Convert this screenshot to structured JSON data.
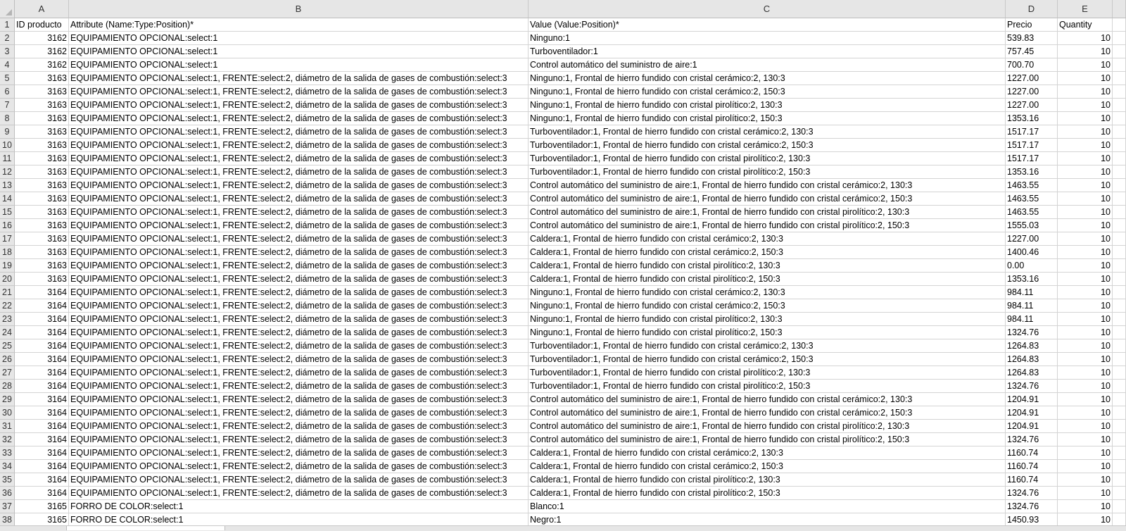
{
  "columns": [
    "A",
    "B",
    "C",
    "D",
    "E"
  ],
  "header_row": {
    "num": "1",
    "id": "ID producto",
    "attr": "Attribute (Name:Type:Position)*",
    "value": "Value (Value:Position)*",
    "price": "Precio",
    "qty": "Quantity"
  },
  "rows": [
    {
      "num": "2",
      "id": "3162",
      "attr": "EQUIPAMIENTO OPCIONAL:select:1",
      "value": "Ninguno:1",
      "price": "539.83",
      "qty": "10"
    },
    {
      "num": "3",
      "id": "3162",
      "attr": "EQUIPAMIENTO OPCIONAL:select:1",
      "value": "Turboventilador:1",
      "price": "757.45",
      "qty": "10"
    },
    {
      "num": "4",
      "id": "3162",
      "attr": "EQUIPAMIENTO OPCIONAL:select:1",
      "value": "Control automático del suministro de aire:1",
      "price": "700.70",
      "qty": "10"
    },
    {
      "num": "5",
      "id": "3163",
      "attr": "EQUIPAMIENTO OPCIONAL:select:1, FRENTE:select:2, diámetro de la salida de gases de combustión:select:3",
      "value": "Ninguno:1, Frontal de hierro fundido con cristal cerámico:2, 130:3",
      "price": "1227.00",
      "qty": "10"
    },
    {
      "num": "6",
      "id": "3163",
      "attr": "EQUIPAMIENTO OPCIONAL:select:1, FRENTE:select:2, diámetro de la salida de gases de combustión:select:3",
      "value": "Ninguno:1, Frontal de hierro fundido con cristal cerámico:2, 150:3",
      "price": "1227.00",
      "qty": "10"
    },
    {
      "num": "7",
      "id": "3163",
      "attr": "EQUIPAMIENTO OPCIONAL:select:1, FRENTE:select:2, diámetro de la salida de gases de combustión:select:3",
      "value": "Ninguno:1, Frontal de hierro fundido con cristal pirolítico:2, 130:3",
      "price": "1227.00",
      "qty": "10"
    },
    {
      "num": "8",
      "id": "3163",
      "attr": "EQUIPAMIENTO OPCIONAL:select:1, FRENTE:select:2, diámetro de la salida de gases de combustión:select:3",
      "value": "Ninguno:1, Frontal de hierro fundido con cristal pirolítico:2, 150:3",
      "price": "1353.16",
      "qty": "10"
    },
    {
      "num": "9",
      "id": "3163",
      "attr": "EQUIPAMIENTO OPCIONAL:select:1, FRENTE:select:2, diámetro de la salida de gases de combustión:select:3",
      "value": "Turboventilador:1, Frontal de hierro fundido con cristal cerámico:2, 130:3",
      "price": "1517.17",
      "qty": "10"
    },
    {
      "num": "10",
      "id": "3163",
      "attr": "EQUIPAMIENTO OPCIONAL:select:1, FRENTE:select:2, diámetro de la salida de gases de combustión:select:3",
      "value": "Turboventilador:1, Frontal de hierro fundido con cristal cerámico:2, 150:3",
      "price": "1517.17",
      "qty": "10"
    },
    {
      "num": "11",
      "id": "3163",
      "attr": "EQUIPAMIENTO OPCIONAL:select:1, FRENTE:select:2, diámetro de la salida de gases de combustión:select:3",
      "value": "Turboventilador:1, Frontal de hierro fundido con cristal pirolítico:2, 130:3",
      "price": "1517.17",
      "qty": "10"
    },
    {
      "num": "12",
      "id": "3163",
      "attr": "EQUIPAMIENTO OPCIONAL:select:1, FRENTE:select:2, diámetro de la salida de gases de combustión:select:3",
      "value": "Turboventilador:1, Frontal de hierro fundido con cristal pirolítico:2, 150:3",
      "price": "1353.16",
      "qty": "10"
    },
    {
      "num": "13",
      "id": "3163",
      "attr": "EQUIPAMIENTO OPCIONAL:select:1, FRENTE:select:2, diámetro de la salida de gases de combustión:select:3",
      "value": "Control automático del suministro de aire:1, Frontal de hierro fundido con cristal cerámico:2, 130:3",
      "price": "1463.55",
      "qty": "10"
    },
    {
      "num": "14",
      "id": "3163",
      "attr": "EQUIPAMIENTO OPCIONAL:select:1, FRENTE:select:2, diámetro de la salida de gases de combustión:select:3",
      "value": "Control automático del suministro de aire:1, Frontal de hierro fundido con cristal cerámico:2, 150:3",
      "price": "1463.55",
      "qty": "10"
    },
    {
      "num": "15",
      "id": "3163",
      "attr": "EQUIPAMIENTO OPCIONAL:select:1, FRENTE:select:2, diámetro de la salida de gases de combustión:select:3",
      "value": "Control automático del suministro de aire:1, Frontal de hierro fundido con cristal pirolítico:2, 130:3",
      "price": "1463.55",
      "qty": "10"
    },
    {
      "num": "16",
      "id": "3163",
      "attr": "EQUIPAMIENTO OPCIONAL:select:1, FRENTE:select:2, diámetro de la salida de gases de combustión:select:3",
      "value": "Control automático del suministro de aire:1, Frontal de hierro fundido con cristal pirolítico:2, 150:3",
      "price": "1555.03",
      "qty": "10"
    },
    {
      "num": "17",
      "id": "3163",
      "attr": "EQUIPAMIENTO OPCIONAL:select:1, FRENTE:select:2, diámetro de la salida de gases de combustión:select:3",
      "value": "Caldera:1, Frontal de hierro fundido con cristal cerámico:2, 130:3",
      "price": "1227.00",
      "qty": "10"
    },
    {
      "num": "18",
      "id": "3163",
      "attr": "EQUIPAMIENTO OPCIONAL:select:1, FRENTE:select:2, diámetro de la salida de gases de combustión:select:3",
      "value": "Caldera:1, Frontal de hierro fundido con cristal cerámico:2, 150:3",
      "price": "1400.46",
      "qty": "10"
    },
    {
      "num": "19",
      "id": "3163",
      "attr": "EQUIPAMIENTO OPCIONAL:select:1, FRENTE:select:2, diámetro de la salida de gases de combustión:select:3",
      "value": "Caldera:1, Frontal de hierro fundido con cristal pirolítico:2, 130:3",
      "price": "0.00",
      "qty": "10"
    },
    {
      "num": "20",
      "id": "3163",
      "attr": "EQUIPAMIENTO OPCIONAL:select:1, FRENTE:select:2, diámetro de la salida de gases de combustión:select:3",
      "value": "Caldera:1, Frontal de hierro fundido con cristal pirolítico:2, 150:3",
      "price": "1353.16",
      "qty": "10"
    },
    {
      "num": "21",
      "id": "3164",
      "attr": "EQUIPAMIENTO OPCIONAL:select:1, FRENTE:select:2, diámetro de la salida de gases de combustión:select:3",
      "value": "Ninguno:1, Frontal de hierro fundido con cristal cerámico:2, 130:3",
      "price": "984.11",
      "qty": "10"
    },
    {
      "num": "22",
      "id": "3164",
      "attr": "EQUIPAMIENTO OPCIONAL:select:1, FRENTE:select:2, diámetro de la salida de gases de combustión:select:3",
      "value": "Ninguno:1, Frontal de hierro fundido con cristal cerámico:2, 150:3",
      "price": "984.11",
      "qty": "10"
    },
    {
      "num": "23",
      "id": "3164",
      "attr": "EQUIPAMIENTO OPCIONAL:select:1, FRENTE:select:2, diámetro de la salida de gases de combustión:select:3",
      "value": "Ninguno:1, Frontal de hierro fundido con cristal pirolítico:2, 130:3",
      "price": "984.11",
      "qty": "10"
    },
    {
      "num": "24",
      "id": "3164",
      "attr": "EQUIPAMIENTO OPCIONAL:select:1, FRENTE:select:2, diámetro de la salida de gases de combustión:select:3",
      "value": "Ninguno:1, Frontal de hierro fundido con cristal pirolítico:2, 150:3",
      "price": "1324.76",
      "qty": "10"
    },
    {
      "num": "25",
      "id": "3164",
      "attr": "EQUIPAMIENTO OPCIONAL:select:1, FRENTE:select:2, diámetro de la salida de gases de combustión:select:3",
      "value": "Turboventilador:1, Frontal de hierro fundido con cristal cerámico:2, 130:3",
      "price": "1264.83",
      "qty": "10"
    },
    {
      "num": "26",
      "id": "3164",
      "attr": "EQUIPAMIENTO OPCIONAL:select:1, FRENTE:select:2, diámetro de la salida de gases de combustión:select:3",
      "value": "Turboventilador:1, Frontal de hierro fundido con cristal cerámico:2, 150:3",
      "price": "1264.83",
      "qty": "10"
    },
    {
      "num": "27",
      "id": "3164",
      "attr": "EQUIPAMIENTO OPCIONAL:select:1, FRENTE:select:2, diámetro de la salida de gases de combustión:select:3",
      "value": "Turboventilador:1, Frontal de hierro fundido con cristal pirolítico:2, 130:3",
      "price": "1264.83",
      "qty": "10"
    },
    {
      "num": "28",
      "id": "3164",
      "attr": "EQUIPAMIENTO OPCIONAL:select:1, FRENTE:select:2, diámetro de la salida de gases de combustión:select:3",
      "value": "Turboventilador:1, Frontal de hierro fundido con cristal pirolítico:2, 150:3",
      "price": "1324.76",
      "qty": "10"
    },
    {
      "num": "29",
      "id": "3164",
      "attr": "EQUIPAMIENTO OPCIONAL:select:1, FRENTE:select:2, diámetro de la salida de gases de combustión:select:3",
      "value": "Control automático del suministro de aire:1, Frontal de hierro fundido con cristal cerámico:2, 130:3",
      "price": "1204.91",
      "qty": "10"
    },
    {
      "num": "30",
      "id": "3164",
      "attr": "EQUIPAMIENTO OPCIONAL:select:1, FRENTE:select:2, diámetro de la salida de gases de combustión:select:3",
      "value": "Control automático del suministro de aire:1, Frontal de hierro fundido con cristal cerámico:2, 150:3",
      "price": "1204.91",
      "qty": "10"
    },
    {
      "num": "31",
      "id": "3164",
      "attr": "EQUIPAMIENTO OPCIONAL:select:1, FRENTE:select:2, diámetro de la salida de gases de combustión:select:3",
      "value": "Control automático del suministro de aire:1, Frontal de hierro fundido con cristal pirolítico:2, 130:3",
      "price": "1204.91",
      "qty": "10"
    },
    {
      "num": "32",
      "id": "3164",
      "attr": "EQUIPAMIENTO OPCIONAL:select:1, FRENTE:select:2, diámetro de la salida de gases de combustión:select:3",
      "value": "Control automático del suministro de aire:1, Frontal de hierro fundido con cristal pirolítico:2, 150:3",
      "price": "1324.76",
      "qty": "10"
    },
    {
      "num": "33",
      "id": "3164",
      "attr": "EQUIPAMIENTO OPCIONAL:select:1, FRENTE:select:2, diámetro de la salida de gases de combustión:select:3",
      "value": "Caldera:1, Frontal de hierro fundido con cristal cerámico:2, 130:3",
      "price": "1160.74",
      "qty": "10"
    },
    {
      "num": "34",
      "id": "3164",
      "attr": "EQUIPAMIENTO OPCIONAL:select:1, FRENTE:select:2, diámetro de la salida de gases de combustión:select:3",
      "value": "Caldera:1, Frontal de hierro fundido con cristal cerámico:2, 150:3",
      "price": "1160.74",
      "qty": "10"
    },
    {
      "num": "35",
      "id": "3164",
      "attr": "EQUIPAMIENTO OPCIONAL:select:1, FRENTE:select:2, diámetro de la salida de gases de combustión:select:3",
      "value": "Caldera:1, Frontal de hierro fundido con cristal pirolítico:2, 130:3",
      "price": "1160.74",
      "qty": "10"
    },
    {
      "num": "36",
      "id": "3164",
      "attr": "EQUIPAMIENTO OPCIONAL:select:1, FRENTE:select:2, diámetro de la salida de gases de combustión:select:3",
      "value": "Caldera:1, Frontal de hierro fundido con cristal pirolítico:2, 150:3",
      "price": "1324.76",
      "qty": "10"
    },
    {
      "num": "37",
      "id": "3165",
      "attr": "FORRO DE COLOR:select:1",
      "value": "Blanco:1",
      "price": "1324.76",
      "qty": "10"
    },
    {
      "num": "38",
      "id": "3165",
      "attr": "FORRO DE COLOR:select:1",
      "value": "Negro:1",
      "price": "1450.93",
      "qty": "10"
    }
  ]
}
